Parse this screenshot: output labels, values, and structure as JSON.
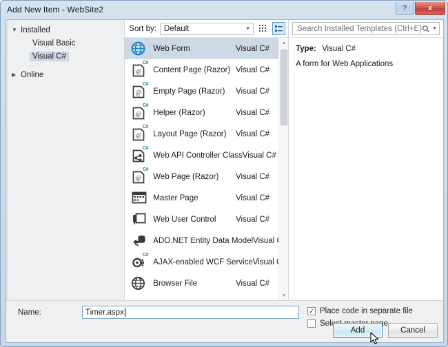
{
  "window": {
    "title": "Add New Item - WebSite2",
    "help_button": "?",
    "close_button": "x"
  },
  "tree": {
    "root": {
      "label": "Installed",
      "expander": "expanded"
    },
    "children": [
      {
        "label": "Visual Basic",
        "selected": false
      },
      {
        "label": "Visual C#",
        "selected": true
      }
    ],
    "online": {
      "label": "Online",
      "expander": "collapsed"
    }
  },
  "toolbar": {
    "sort_by_label": "Sort by:",
    "sort_by_value": "Default",
    "grid_view_name": "grid-view-icon",
    "list_view_name": "list-view-icon"
  },
  "search": {
    "placeholder": "Search Installed Templates (Ctrl+E)"
  },
  "templates": [
    {
      "name": "Web Form",
      "lang": "Visual C#",
      "icon": "globe-icon",
      "selected": true
    },
    {
      "name": "Content Page (Razor)",
      "lang": "Visual C#",
      "icon": "razor-page-icon",
      "selected": false
    },
    {
      "name": "Empty Page (Razor)",
      "lang": "Visual C#",
      "icon": "razor-page-icon",
      "selected": false
    },
    {
      "name": "Helper (Razor)",
      "lang": "Visual C#",
      "icon": "razor-page-icon",
      "selected": false
    },
    {
      "name": "Layout Page (Razor)",
      "lang": "Visual C#",
      "icon": "razor-page-icon",
      "selected": false
    },
    {
      "name": "Web API Controller Class",
      "lang": "Visual C#",
      "icon": "web-api-icon",
      "selected": false
    },
    {
      "name": "Web Page (Razor)",
      "lang": "Visual C#",
      "icon": "razor-page-icon",
      "selected": false
    },
    {
      "name": "Master Page",
      "lang": "Visual C#",
      "icon": "master-page-icon",
      "selected": false
    },
    {
      "name": "Web User Control",
      "lang": "Visual C#",
      "icon": "user-control-icon",
      "selected": false
    },
    {
      "name": "ADO.NET Entity Data Model",
      "lang": "Visual C#",
      "icon": "entity-data-model-icon",
      "selected": false
    },
    {
      "name": "AJAX-enabled WCF Service",
      "lang": "Visual C#",
      "icon": "wcf-service-icon",
      "selected": false
    },
    {
      "name": "Browser File",
      "lang": "Visual C#",
      "icon": "browser-file-icon",
      "selected": false
    }
  ],
  "details": {
    "type_label": "Type:",
    "type_value": "Visual C#",
    "description": "A form for Web Applications"
  },
  "footer": {
    "name_label": "Name:",
    "name_value": "Timer.aspx",
    "checkbox_place_code": {
      "label": "Place code in separate file",
      "checked": true,
      "mark": "✓"
    },
    "checkbox_master_page": {
      "label": "Select master page",
      "checked": false,
      "mark": ""
    },
    "add_button": "Add",
    "cancel_button": "Cancel"
  },
  "colors": {
    "selection": "#cfd9e6",
    "accent": "#3c9ab5",
    "close_red": "#d2514c",
    "globe_blue": "#1b8ac4",
    "cs_badge_green": "#1f8a3b"
  }
}
